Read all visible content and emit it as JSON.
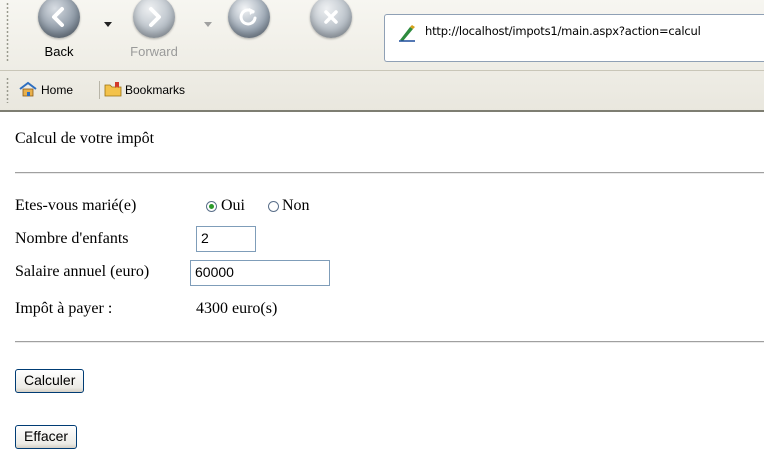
{
  "browser": {
    "back_label": "Back",
    "forward_label": "Forward",
    "address_url": "http://localhost/impots1/main.aspx?action=calcul",
    "bookmarks": [
      {
        "label": "Home",
        "icon": "home-icon"
      },
      {
        "label": "Bookmarks",
        "icon": "bookmarks-folder-icon"
      }
    ]
  },
  "page": {
    "title": "Calcul de votre impôt",
    "married_label": "Etes-vous marié(e)",
    "married_options": [
      "Oui",
      "Non"
    ],
    "married_selected": "Oui",
    "children_label": "Nombre d'enfants",
    "children_value": "2",
    "salary_label": "Salaire annuel (euro)",
    "salary_value": "60000",
    "tax_label": "Impôt à payer :",
    "tax_value": "4300 euro(s)",
    "calculate_button": "Calculer",
    "clear_button": "Effacer"
  },
  "colors": {
    "radio_selected": "#2b9a2b",
    "input_border": "#7f9db9",
    "button_border": "#003c74"
  }
}
